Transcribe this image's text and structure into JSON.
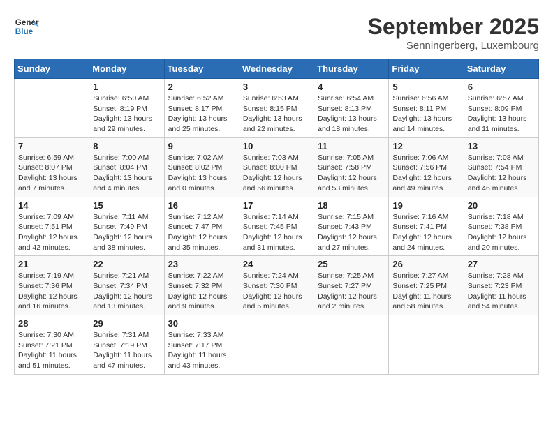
{
  "header": {
    "logo_line1": "General",
    "logo_line2": "Blue",
    "month_title": "September 2025",
    "subtitle": "Senningerberg, Luxembourg"
  },
  "days_of_week": [
    "Sunday",
    "Monday",
    "Tuesday",
    "Wednesday",
    "Thursday",
    "Friday",
    "Saturday"
  ],
  "weeks": [
    [
      {
        "day": "",
        "info": ""
      },
      {
        "day": "1",
        "info": "Sunrise: 6:50 AM\nSunset: 8:19 PM\nDaylight: 13 hours\nand 29 minutes."
      },
      {
        "day": "2",
        "info": "Sunrise: 6:52 AM\nSunset: 8:17 PM\nDaylight: 13 hours\nand 25 minutes."
      },
      {
        "day": "3",
        "info": "Sunrise: 6:53 AM\nSunset: 8:15 PM\nDaylight: 13 hours\nand 22 minutes."
      },
      {
        "day": "4",
        "info": "Sunrise: 6:54 AM\nSunset: 8:13 PM\nDaylight: 13 hours\nand 18 minutes."
      },
      {
        "day": "5",
        "info": "Sunrise: 6:56 AM\nSunset: 8:11 PM\nDaylight: 13 hours\nand 14 minutes."
      },
      {
        "day": "6",
        "info": "Sunrise: 6:57 AM\nSunset: 8:09 PM\nDaylight: 13 hours\nand 11 minutes."
      }
    ],
    [
      {
        "day": "7",
        "info": "Sunrise: 6:59 AM\nSunset: 8:07 PM\nDaylight: 13 hours\nand 7 minutes."
      },
      {
        "day": "8",
        "info": "Sunrise: 7:00 AM\nSunset: 8:04 PM\nDaylight: 13 hours\nand 4 minutes."
      },
      {
        "day": "9",
        "info": "Sunrise: 7:02 AM\nSunset: 8:02 PM\nDaylight: 13 hours\nand 0 minutes."
      },
      {
        "day": "10",
        "info": "Sunrise: 7:03 AM\nSunset: 8:00 PM\nDaylight: 12 hours\nand 56 minutes."
      },
      {
        "day": "11",
        "info": "Sunrise: 7:05 AM\nSunset: 7:58 PM\nDaylight: 12 hours\nand 53 minutes."
      },
      {
        "day": "12",
        "info": "Sunrise: 7:06 AM\nSunset: 7:56 PM\nDaylight: 12 hours\nand 49 minutes."
      },
      {
        "day": "13",
        "info": "Sunrise: 7:08 AM\nSunset: 7:54 PM\nDaylight: 12 hours\nand 46 minutes."
      }
    ],
    [
      {
        "day": "14",
        "info": "Sunrise: 7:09 AM\nSunset: 7:51 PM\nDaylight: 12 hours\nand 42 minutes."
      },
      {
        "day": "15",
        "info": "Sunrise: 7:11 AM\nSunset: 7:49 PM\nDaylight: 12 hours\nand 38 minutes."
      },
      {
        "day": "16",
        "info": "Sunrise: 7:12 AM\nSunset: 7:47 PM\nDaylight: 12 hours\nand 35 minutes."
      },
      {
        "day": "17",
        "info": "Sunrise: 7:14 AM\nSunset: 7:45 PM\nDaylight: 12 hours\nand 31 minutes."
      },
      {
        "day": "18",
        "info": "Sunrise: 7:15 AM\nSunset: 7:43 PM\nDaylight: 12 hours\nand 27 minutes."
      },
      {
        "day": "19",
        "info": "Sunrise: 7:16 AM\nSunset: 7:41 PM\nDaylight: 12 hours\nand 24 minutes."
      },
      {
        "day": "20",
        "info": "Sunrise: 7:18 AM\nSunset: 7:38 PM\nDaylight: 12 hours\nand 20 minutes."
      }
    ],
    [
      {
        "day": "21",
        "info": "Sunrise: 7:19 AM\nSunset: 7:36 PM\nDaylight: 12 hours\nand 16 minutes."
      },
      {
        "day": "22",
        "info": "Sunrise: 7:21 AM\nSunset: 7:34 PM\nDaylight: 12 hours\nand 13 minutes."
      },
      {
        "day": "23",
        "info": "Sunrise: 7:22 AM\nSunset: 7:32 PM\nDaylight: 12 hours\nand 9 minutes."
      },
      {
        "day": "24",
        "info": "Sunrise: 7:24 AM\nSunset: 7:30 PM\nDaylight: 12 hours\nand 5 minutes."
      },
      {
        "day": "25",
        "info": "Sunrise: 7:25 AM\nSunset: 7:27 PM\nDaylight: 12 hours\nand 2 minutes."
      },
      {
        "day": "26",
        "info": "Sunrise: 7:27 AM\nSunset: 7:25 PM\nDaylight: 11 hours\nand 58 minutes."
      },
      {
        "day": "27",
        "info": "Sunrise: 7:28 AM\nSunset: 7:23 PM\nDaylight: 11 hours\nand 54 minutes."
      }
    ],
    [
      {
        "day": "28",
        "info": "Sunrise: 7:30 AM\nSunset: 7:21 PM\nDaylight: 11 hours\nand 51 minutes."
      },
      {
        "day": "29",
        "info": "Sunrise: 7:31 AM\nSunset: 7:19 PM\nDaylight: 11 hours\nand 47 minutes."
      },
      {
        "day": "30",
        "info": "Sunrise: 7:33 AM\nSunset: 7:17 PM\nDaylight: 11 hours\nand 43 minutes."
      },
      {
        "day": "",
        "info": ""
      },
      {
        "day": "",
        "info": ""
      },
      {
        "day": "",
        "info": ""
      },
      {
        "day": "",
        "info": ""
      }
    ]
  ]
}
